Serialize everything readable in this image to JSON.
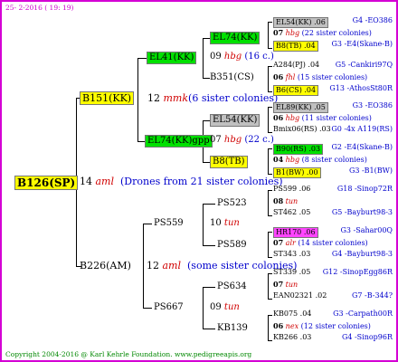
{
  "header": {
    "date": "25- 2-2016 ( 19: 19)"
  },
  "footer": {
    "copyright": "Copyright 2004-2016 @ Karl Kehrle Foundation.   www.pedigreeapis.org"
  },
  "root": {
    "id": "B126(SP)",
    "gen": "14",
    "race": "aml",
    "note": "(Drones from 21 sister colonies)"
  },
  "g1": [
    {
      "id": "B151(KK)",
      "gen": "12",
      "race": "mmk",
      "note": "(6 sister colonies)"
    },
    {
      "id": "B226(AM)",
      "gen": "12",
      "race": "aml",
      "note": "(some sister colonies)"
    }
  ],
  "g2": [
    {
      "id": "EL41(KK)",
      "gen": "09",
      "race": "hbg",
      "note": "(16 c.)"
    },
    {
      "id": "B351(CS)"
    },
    {
      "id": "EL74(KK)gpp",
      "gen": "07",
      "race": "hbg",
      "note": "(22 c.)"
    },
    {
      "id": "PS559",
      "gen": "10",
      "race": "tun"
    },
    {
      "id": "PS667",
      "gen": "09",
      "race": "tun"
    }
  ],
  "g3": [
    {
      "id": "EL74(KK)"
    },
    {
      "id": "EL54(KK)"
    },
    {
      "id": "B8(TB)"
    },
    {
      "id": "PS523",
      "gen": "08",
      "race": "tun"
    },
    {
      "id": "PS589",
      "gen": "07",
      "race": "alr",
      "note": "(14 sister colonies)"
    },
    {
      "id": "PS634",
      "gen": "07",
      "race": "tun"
    },
    {
      "id": "KB139",
      "gen": "06",
      "race": "nex",
      "note": "(12 sister colonies)"
    }
  ],
  "g4": [
    {
      "id": "EL54(KK) .06",
      "right": "G4 -EO386"
    },
    {
      "gen": "07",
      "race": "hbg",
      "note": "(22 sister colonies)"
    },
    {
      "id": "B8(TB) .04",
      "right": "G3 -E4(Skane-B)"
    },
    {
      "id": "A284(PJ) .04",
      "right": "G5 -Cankiri97Q"
    },
    {
      "gen": "06",
      "race": "fhl",
      "note": "(15 sister colonies)"
    },
    {
      "id": "B6(CS) .04",
      "right": "G13 -AthosSt80R"
    },
    {
      "id": "EL89(KK) .05",
      "right": "G3 -EO386"
    },
    {
      "gen": "06",
      "race": "hbg",
      "note": "(11 sister colonies)"
    },
    {
      "id": "Bmix06(RS) .03",
      "right": "G0 -4x A119(RS)"
    },
    {
      "id": "B90(RS) .03",
      "right": "G2 -E4(Skane-B)"
    },
    {
      "gen": "04",
      "race": "hbg",
      "note": "(8 sister colonies)"
    },
    {
      "id": "B1(BW) .00",
      "right": "G3 -B1(BW)"
    },
    {
      "id": "PS599 .06",
      "right": "G18 -Sinop72R"
    },
    {
      "gen": "08",
      "race": "tun"
    },
    {
      "id": "ST462 .05",
      "right": "G5 -Bayburt98-3"
    },
    {
      "id": "HR170 .06",
      "right": "G3 -Sahar00Q"
    },
    {
      "gen": "07",
      "race": "alr",
      "note": "(14 sister colonies)"
    },
    {
      "id": "ST343 .03",
      "right": "G4 -Bayburt98-3"
    },
    {
      "id": "ST339 .05",
      "right": "G12 -SinopEgg86R"
    },
    {
      "gen": "07",
      "race": "tun"
    },
    {
      "id": "EAN02321 .02",
      "right": "G7 -B-344?"
    },
    {
      "id": "KB075 .04",
      "right": "G3 -Carpath00R"
    },
    {
      "gen": "06",
      "race": "nex",
      "note": "(12 sister colonies)"
    },
    {
      "id": "KB266 .03",
      "right": "G4 -Sinop96R"
    }
  ]
}
